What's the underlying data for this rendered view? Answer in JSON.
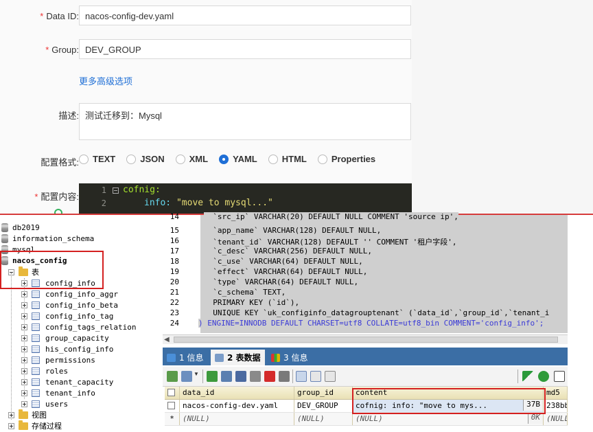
{
  "nacos": {
    "data_id_label": "Data ID:",
    "data_id_value": "nacos-config-dev.yaml",
    "group_label": "Group:",
    "group_value": "DEV_GROUP",
    "advanced_link": "更多高级选项",
    "desc_label": "描述:",
    "desc_value": "测试迁移到：Mysql",
    "format_label": "配置格式:",
    "formats": [
      "TEXT",
      "JSON",
      "XML",
      "YAML",
      "HTML",
      "Properties"
    ],
    "selected_format": "YAML",
    "content_label": "配置内容:",
    "editor_lines": [
      {
        "n": "1",
        "key": "cofnig:",
        "val": ""
      },
      {
        "n": "2",
        "key": "info:",
        "val": " \"move to mysql...\""
      }
    ]
  },
  "tree": {
    "databases": [
      "db2019",
      "information_schema",
      "mysql",
      "nacos_config"
    ],
    "tables_folder": "表",
    "tables": [
      "config_info",
      "config_info_aggr",
      "config_info_beta",
      "config_info_tag",
      "config_tags_relation",
      "group_capacity",
      "his_config_info",
      "permissions",
      "roles",
      "tenant_capacity",
      "tenant_info",
      "users"
    ],
    "views_folder": "视图",
    "procs_folder": "存储过程"
  },
  "sql": {
    "lines": [
      {
        "n": "14",
        "text": "  `src_ip` VARCHAR(20) DEFAULT NULL COMMENT 'source ip',"
      },
      {
        "n": "15",
        "text": "  `app_name` VARCHAR(128) DEFAULT NULL,"
      },
      {
        "n": "16",
        "text": "  `tenant_id` VARCHAR(128) DEFAULT '' COMMENT '租户字段',"
      },
      {
        "n": "17",
        "text": "  `c_desc` VARCHAR(256) DEFAULT NULL,"
      },
      {
        "n": "18",
        "text": "  `c_use` VARCHAR(64) DEFAULT NULL,"
      },
      {
        "n": "19",
        "text": "  `effect` VARCHAR(64) DEFAULT NULL,"
      },
      {
        "n": "20",
        "text": "  `type` VARCHAR(64) DEFAULT NULL,"
      },
      {
        "n": "21",
        "text": "  `c_schema` TEXT,"
      },
      {
        "n": "22",
        "text": "  PRIMARY KEY (`id`),"
      },
      {
        "n": "23",
        "text": "  UNIQUE KEY `uk_configinfo_datagrouptenant` (`data_id`,`group_id`,`tenant_i"
      },
      {
        "n": "24",
        "text": ") ENGINE=INNODB DEFAULT CHARSET=utf8 COLLATE=utf8_bin COMMENT='config_info';"
      }
    ]
  },
  "tabs": [
    {
      "label": "1 信息",
      "active": false
    },
    {
      "label": "2 表数据",
      "active": true
    },
    {
      "label": "3 信息",
      "active": false
    }
  ],
  "grid": {
    "columns": [
      "data_id",
      "group_id",
      "content",
      "md5"
    ],
    "rows": [
      {
        "data_id": "nacos-config-dev.yaml",
        "group_id": "DEV_GROUP",
        "content": "cofnig:    info: \"move to mys...",
        "size": "37B",
        "md5": "238bb"
      },
      {
        "marker": "*",
        "data_id": "(NULL)",
        "group_id": "(NULL)",
        "content": "(NULL)",
        "size": "0K",
        "md5": "(NULL"
      }
    ]
  },
  "colors": {
    "accent": "#1f6fd6",
    "annotation": "#d42020",
    "tabbar": "#3b6ea5"
  }
}
